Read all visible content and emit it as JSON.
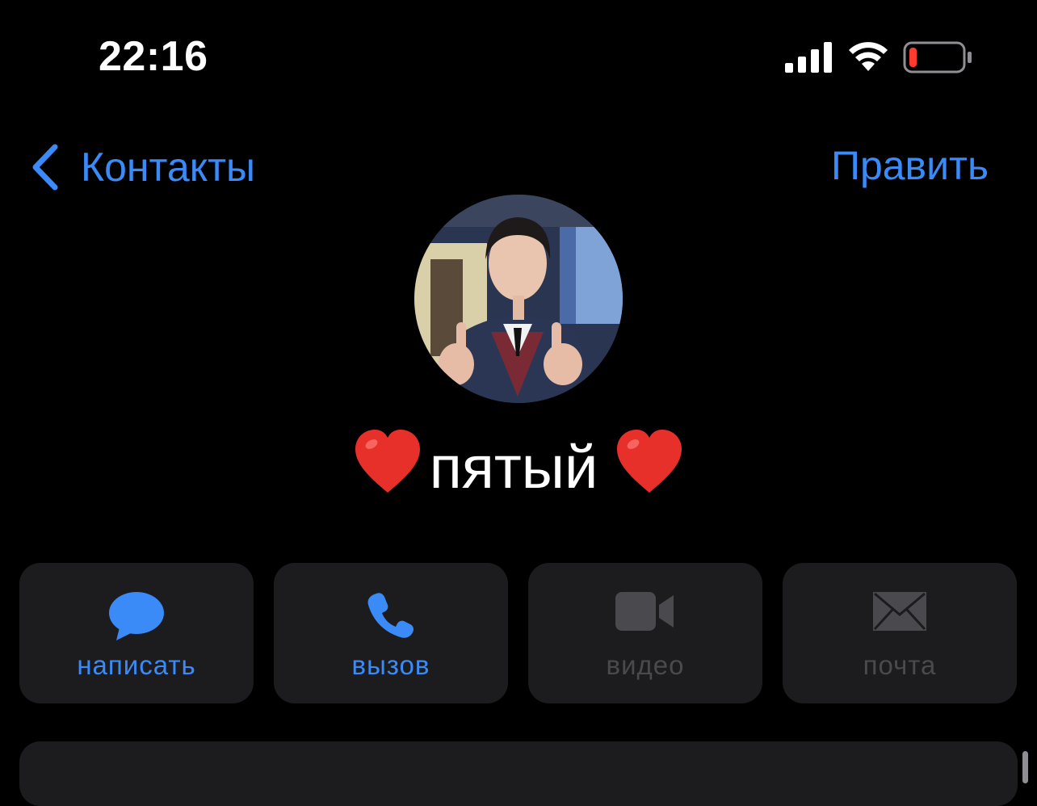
{
  "status_bar": {
    "time": "22:16",
    "signal_icon": "cellular-signal-icon",
    "wifi_icon": "wifi-icon",
    "battery_icon": "battery-low-icon",
    "battery_level": 0.12,
    "battery_color": "#ff3b30"
  },
  "nav": {
    "back_label": "Контакты",
    "back_icon": "chevron-left-icon",
    "edit_label": "Править"
  },
  "contact": {
    "avatar_icon": "contact-photo",
    "name": "пятый",
    "heart_icon": "red-heart-icon"
  },
  "actions": [
    {
      "label": "написать",
      "icon": "message-bubble-icon",
      "enabled": true
    },
    {
      "label": "вызов",
      "icon": "phone-icon",
      "enabled": true
    },
    {
      "label": "видео",
      "icon": "video-camera-icon",
      "enabled": false
    },
    {
      "label": "почта",
      "icon": "mail-envelope-icon",
      "enabled": false
    }
  ],
  "colors": {
    "background": "#000000",
    "accent": "#3a8bf7",
    "card": "#1c1c1e",
    "disabled": "#4a4a4e"
  }
}
